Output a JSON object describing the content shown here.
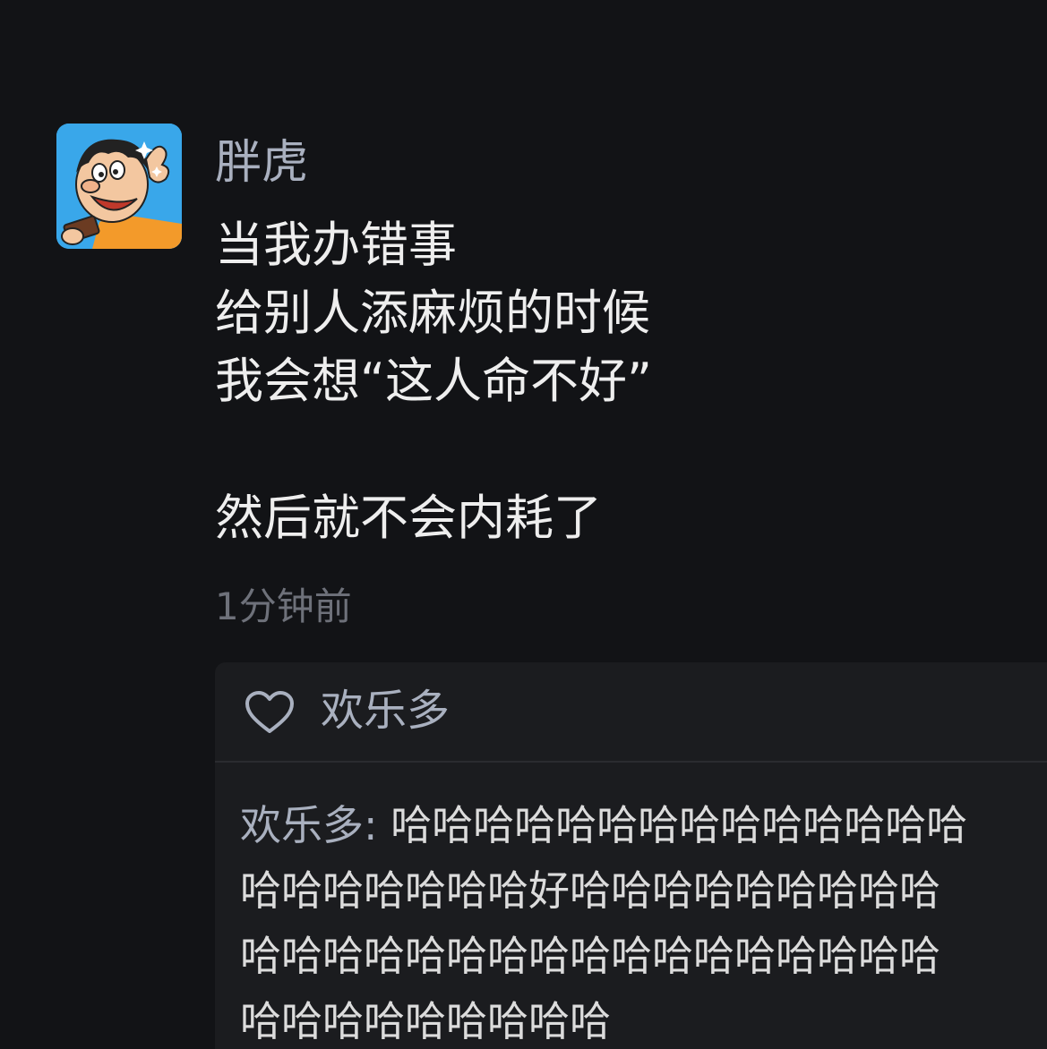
{
  "post": {
    "username": "胖虎",
    "avatar_icon": "cartoon-character-avatar",
    "content_lines": [
      "当我办错事",
      "给别人添麻烦的时候",
      "我会想“这人命不好”"
    ],
    "content_after_gap": "然后就不会内耗了",
    "timestamp": "1分钟前"
  },
  "likes": {
    "icon": "heart-icon",
    "names": "欢乐多"
  },
  "comment": {
    "author": "欢乐多:",
    "lines": [
      " 哈哈哈哈哈哈哈哈哈哈哈哈哈哈",
      "哈哈哈哈哈哈哈好哈哈哈哈哈哈哈哈哈",
      "哈哈哈哈哈哈哈哈哈哈哈哈哈哈哈哈哈",
      "哈哈哈哈哈哈哈哈哈"
    ]
  },
  "colors": {
    "background": "#121316",
    "username": "#a9b0bf",
    "text": "#eeeeee",
    "muted": "#6e717a",
    "panel": "#1b1c1f"
  }
}
